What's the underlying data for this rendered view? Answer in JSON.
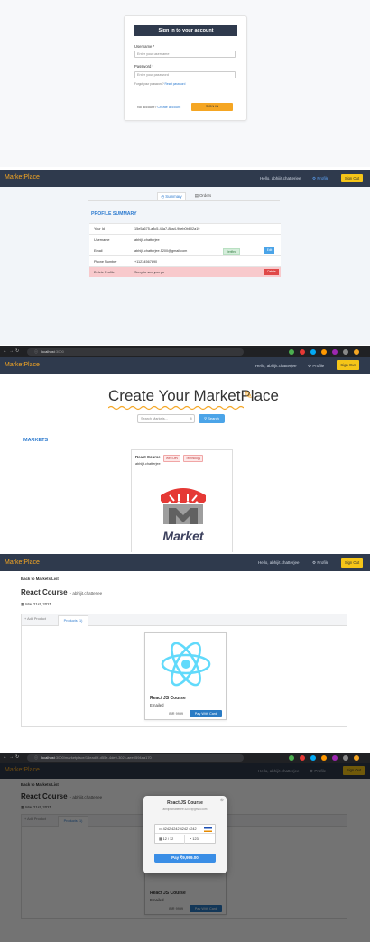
{
  "signin": {
    "title": "Sign in to your account",
    "username_label": "Username *",
    "username_placeholder": "Enter your username",
    "password_label": "Password *",
    "password_placeholder": "Enter your password",
    "forgot_text": "Forgot your password?",
    "reset_link": "Reset password",
    "no_account": "No account?",
    "create_link": "Create account",
    "signin_button": "SIGN IN"
  },
  "navbar": {
    "brand": "MarketPlace",
    "hello": "Hello, abhijit.chatterjee",
    "profile": "Profile",
    "signout": "Sign Out"
  },
  "profile": {
    "tab_summary": "Summary",
    "tab_orders": "Orders",
    "heading": "PROFILE SUMMARY",
    "rows": [
      {
        "key": "Your Id",
        "value": "15e5a675-a8c5-44a7-8ba4-96eb0b602a19"
      },
      {
        "key": "Username",
        "value": "abhijit.chatterjee"
      },
      {
        "key": "Email",
        "value": "abhijit.chatterjee.5200@gmail.com",
        "badge": "Verified",
        "action": "Edit"
      },
      {
        "key": "Phone Number",
        "value": "+11234567890"
      },
      {
        "key": "Delete Profile",
        "value": "Sorry to see you go",
        "action": "Delete"
      }
    ]
  },
  "browser": {
    "url_host": "localhost",
    "url_port": ":3000",
    "url_path": "/marketplace/15ead0f-d55e-4de9-302c-aee0594aa170"
  },
  "markets": {
    "hero": "Create Your MarketPlace",
    "search_placeholder": "Search Markets...",
    "search_button": "Search",
    "heading": "MARKETS",
    "card": {
      "name": "React Course",
      "tags": [
        "Web Dev",
        "Technology"
      ],
      "owner": "abhijit.chatterjee",
      "logo_text": "Market"
    }
  },
  "market_detail": {
    "back": "Back to Markets List",
    "title": "React Course",
    "owner": "- abhijit.chatterjee",
    "date": "Mar 21st, 2021",
    "tab_add": "+ Add Product",
    "tab_products": "Products (1)",
    "product": {
      "name": "React JS Course",
      "status": "Emailed",
      "price": "INR 9999",
      "pay": "Pay With Card"
    }
  },
  "payment_modal": {
    "title": "React JS Course",
    "email": "abhijit.chatterjee.5200@gmail.com",
    "card_number": "4242 4242 4242 4242",
    "expiry": "12 / 12",
    "cvc": "123",
    "pay_button": "Pay ₹9,999.00"
  },
  "colors": {
    "navbar": "#2f3a4d",
    "accent": "#f5a623",
    "link": "#2e7bcf"
  }
}
